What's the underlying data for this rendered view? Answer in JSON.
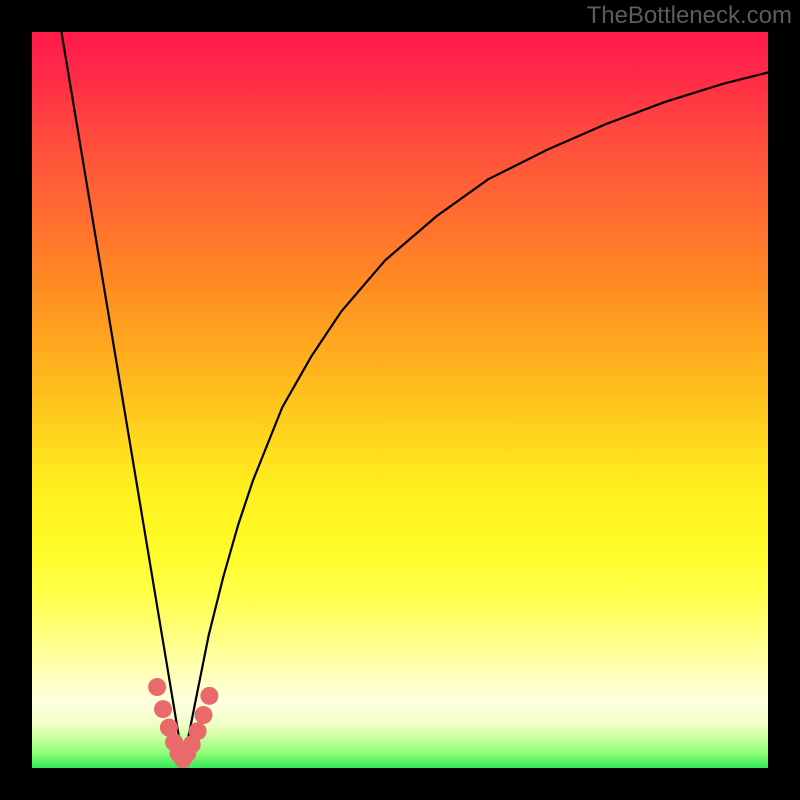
{
  "watermark": "TheBottleneck.com",
  "chart_data": {
    "type": "line",
    "title": "",
    "xlabel": "",
    "ylabel": "",
    "xlim": [
      0,
      100
    ],
    "ylim": [
      0,
      100
    ],
    "grid": false,
    "legend": false,
    "gradient_stops": [
      {
        "pct": 0,
        "color": "#ff1a4b"
      },
      {
        "pct": 6,
        "color": "#ff2b47"
      },
      {
        "pct": 14,
        "color": "#ff4a3e"
      },
      {
        "pct": 24,
        "color": "#ff6a32"
      },
      {
        "pct": 34,
        "color": "#ff8a22"
      },
      {
        "pct": 44,
        "color": "#ffad1e"
      },
      {
        "pct": 54,
        "color": "#ffd21e"
      },
      {
        "pct": 62,
        "color": "#fff01e"
      },
      {
        "pct": 70,
        "color": "#fffb28"
      },
      {
        "pct": 76,
        "color": "#ffff46"
      },
      {
        "pct": 82,
        "color": "#ffff80"
      },
      {
        "pct": 87,
        "color": "#ffffb8"
      },
      {
        "pct": 91,
        "color": "#ffffe0"
      },
      {
        "pct": 94,
        "color": "#f0ffc8"
      },
      {
        "pct": 96,
        "color": "#c8ff9a"
      },
      {
        "pct": 98,
        "color": "#8cff78"
      },
      {
        "pct": 100,
        "color": "#36e85a"
      }
    ],
    "series": [
      {
        "name": "bottleneck-curve",
        "note": "y ≈ 100 at x≈4 and x≈100; dips to y≈0 near x≈20.5; asymmetric V with steep left, shallow right",
        "x": [
          4,
          6,
          8,
          10,
          12,
          14,
          16,
          17,
          18,
          19,
          20,
          20.5,
          21,
          22,
          23,
          24,
          26,
          28,
          30,
          34,
          38,
          42,
          48,
          55,
          62,
          70,
          78,
          86,
          94,
          100
        ],
        "y": [
          100,
          88,
          76,
          64,
          52,
          40,
          28,
          22,
          16,
          10,
          4,
          1,
          3,
          8,
          13,
          18,
          26,
          33,
          39,
          49,
          56,
          62,
          69,
          75,
          80,
          84,
          87.5,
          90.5,
          93,
          94.5
        ]
      }
    ],
    "markers": {
      "name": "trough-dots",
      "color": "#e86a6a",
      "radius_px": 9,
      "x": [
        17.0,
        17.8,
        18.6,
        19.3,
        19.9,
        20.5,
        21.1,
        21.7,
        22.5,
        23.3,
        24.1
      ],
      "y": [
        11.0,
        8.0,
        5.5,
        3.5,
        2.0,
        1.2,
        2.0,
        3.2,
        5.0,
        7.2,
        9.8
      ]
    }
  },
  "colors": {
    "frame": "#000000",
    "curve": "#000000",
    "marker": "#e86a6a",
    "watermark": "#5c5c5c"
  }
}
